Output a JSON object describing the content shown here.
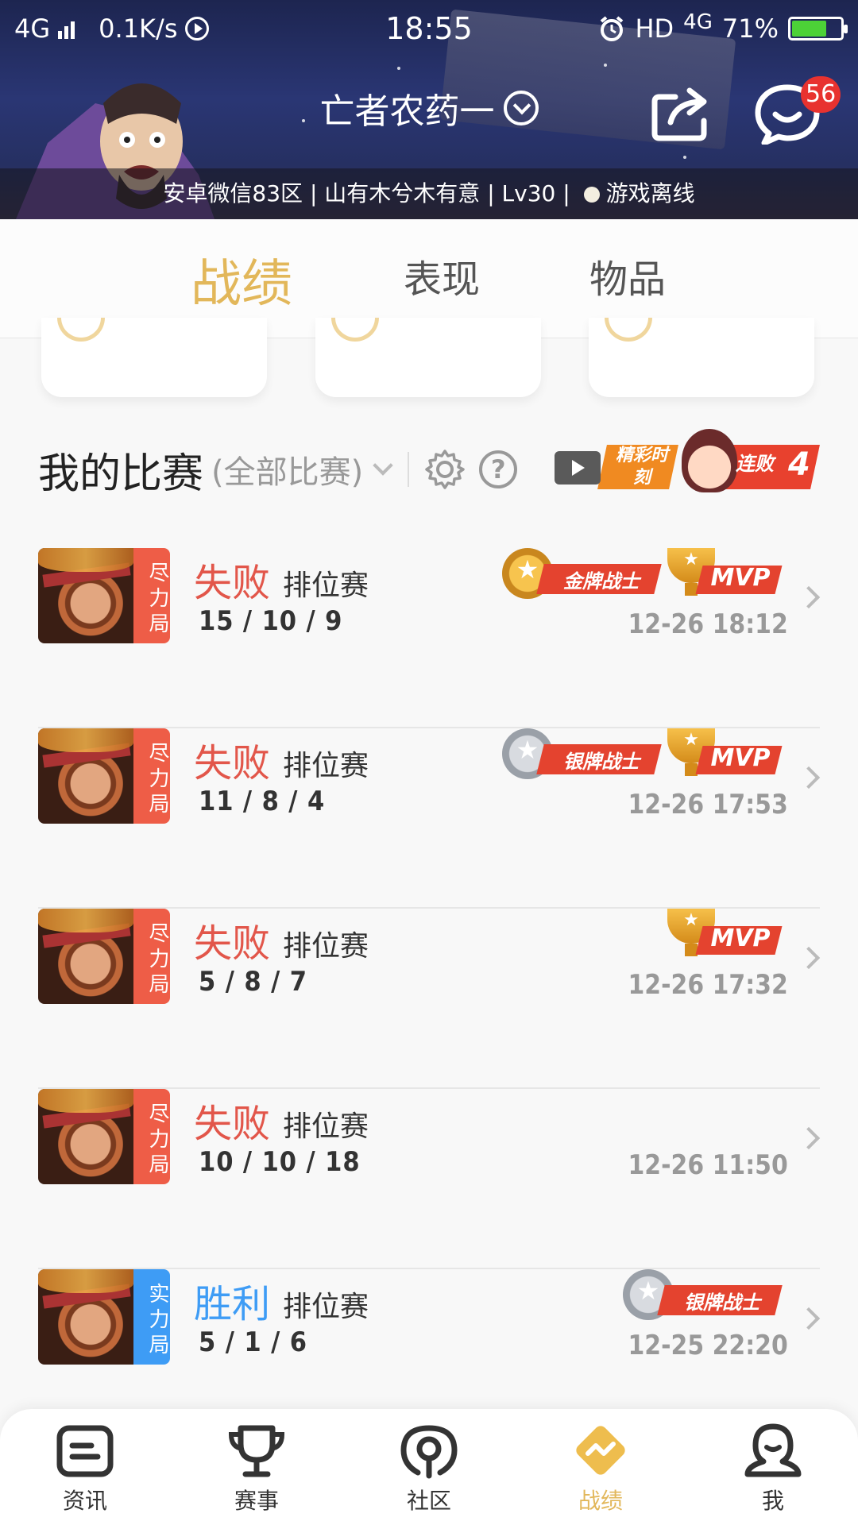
{
  "status_bar": {
    "network": "4G",
    "speed": "0.1K/s",
    "time": "18:55",
    "hd": "HD",
    "network_right": "4G",
    "battery": "71%",
    "battery_level": 0.71
  },
  "header": {
    "account_name": "亡者农药一",
    "message_count": "56",
    "server": "安卓微信83区",
    "role_name": "山有木兮木有意",
    "level": "Lv30",
    "online_status": "游戏离线",
    "sep": " | "
  },
  "tabs": [
    {
      "label": "战绩",
      "active": true
    },
    {
      "label": "表现",
      "active": false
    },
    {
      "label": "物品",
      "active": false
    }
  ],
  "section": {
    "title": "我的比赛",
    "filter": "(全部比赛)",
    "help": "?",
    "highlight_label": "精彩时刻",
    "streak_label": "连败",
    "streak_count": "4"
  },
  "matches": [
    {
      "mode": "尽力局",
      "mode_color": "red",
      "result": "失败",
      "outcome": "lose",
      "type": "排位赛",
      "kda": "15 / 10 / 9",
      "time": "12-26 18:12",
      "badge": "金牌战士",
      "badge_tier": "gold",
      "mvp": "MVP"
    },
    {
      "mode": "尽力局",
      "mode_color": "red",
      "result": "失败",
      "outcome": "lose",
      "type": "排位赛",
      "kda": "11 / 8 / 4",
      "time": "12-26 17:53",
      "badge": "银牌战士",
      "badge_tier": "silver",
      "mvp": "MVP"
    },
    {
      "mode": "尽力局",
      "mode_color": "red",
      "result": "失败",
      "outcome": "lose",
      "type": "排位赛",
      "kda": "5 / 8 / 7",
      "time": "12-26 17:32",
      "badge": "",
      "badge_tier": "",
      "mvp": "MVP"
    },
    {
      "mode": "尽力局",
      "mode_color": "red",
      "result": "失败",
      "outcome": "lose",
      "type": "排位赛",
      "kda": "10 / 10 / 18",
      "time": "12-26 11:50",
      "badge": "",
      "badge_tier": "",
      "mvp": ""
    },
    {
      "mode": "实力局",
      "mode_color": "blue",
      "result": "胜利",
      "outcome": "win",
      "type": "排位赛",
      "kda": "5 / 1 / 6",
      "time": "12-25 22:20",
      "badge": "银牌战士",
      "badge_tier": "silver",
      "mvp": ""
    }
  ],
  "bottom_nav": [
    {
      "label": "资讯",
      "icon": "news-icon",
      "active": false
    },
    {
      "label": "赛事",
      "icon": "trophy-icon",
      "active": false
    },
    {
      "label": "社区",
      "icon": "community-icon",
      "active": false
    },
    {
      "label": "战绩",
      "icon": "stats-icon",
      "active": true
    },
    {
      "label": "我",
      "icon": "profile-icon",
      "active": false
    }
  ],
  "colors": {
    "accent_gold": "#e2b75a",
    "lose_red": "#e2564a",
    "win_blue": "#3e9cf5",
    "badge_red": "#e4432f"
  }
}
